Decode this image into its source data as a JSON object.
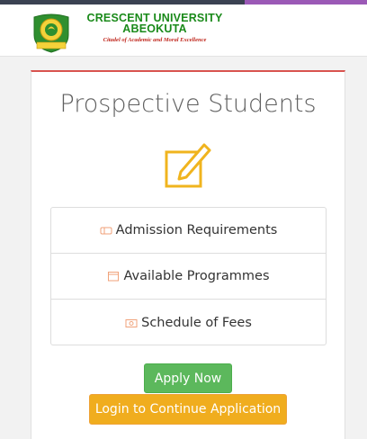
{
  "header": {
    "university_line1": "CRESCENT UNIVERSITY",
    "university_line2": "ABEOKUTA",
    "motto": "Citadel of Academic and Moral Excellence"
  },
  "card": {
    "title": "Prospective Students",
    "icon": "edit-icon",
    "menu": [
      {
        "label": "Admission Requirements",
        "icon": "ticket-icon"
      },
      {
        "label": "Available Programmes",
        "icon": "calendar-icon"
      },
      {
        "label": "Schedule of Fees",
        "icon": "money-icon"
      }
    ],
    "apply_label": "Apply Now",
    "login_label": "Login to Continue Application"
  },
  "colors": {
    "brand_green": "#1a8a1a",
    "motto_red": "#c0281e",
    "accent_gold": "#f0b41e",
    "apply_green": "#5cb85c",
    "login_orange": "#f0ad1e",
    "card_top_border": "#d9534f"
  }
}
